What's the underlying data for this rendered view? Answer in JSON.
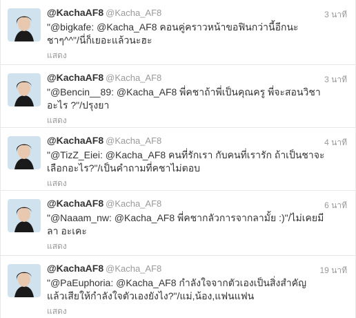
{
  "tweets": [
    {
      "fullname": "@KachaAF8",
      "username": "@Kacha_AF8",
      "time": "3 นาที",
      "text": "\"@bigkafe: @Kacha_AF8 คอนคู่คราวหน้าขอฟินกว่านี้อีกนะ ชาๆ^^\"/นี่ก็เยอะแล้วนะฮะ",
      "expand": "แสดง"
    },
    {
      "fullname": "@KachaAF8",
      "username": "@Kacha_AF8",
      "time": "3 นาที",
      "text": "\"@Bencin__89: @Kacha_AF8 พี่คชาถ้าพี่เป็นคุณครู พี่จะสอนวิชาอะไร ?\"/ปรุงยา",
      "expand": "แสดง"
    },
    {
      "fullname": "@KachaAF8",
      "username": "@Kacha_AF8",
      "time": "4 นาที",
      "text": "\"@TizZ_Eiei: @Kacha_AF8 คนที่รักเรา กับคนที่เรารัก ถ้าเป็นชาจะเลือกอะไร?\"/เป็นคำถามที่คชาไม่ตอบ",
      "expand": "แสดง"
    },
    {
      "fullname": "@KachaAF8",
      "username": "@Kacha_AF8",
      "time": "6 นาที",
      "text": "\"@Naaam_nw: @Kacha_AF8 พี่คชากลัวการจากลามั้ย :)\"/ไม่เคยมีลา อะเคะ",
      "expand": "แสดง"
    },
    {
      "fullname": "@KachaAF8",
      "username": "@Kacha_AF8",
      "time": "19 นาที",
      "text": "\"@PaEuphoria: @Kacha_AF8 กำลังใจจากตัวเองเป็นสิ่งสำคัญ แล้วเสียให้กำลังใจตัวเองยังไง?\"/แม่,น้อง,แฟนแฟน",
      "expand": "แสดง"
    }
  ]
}
